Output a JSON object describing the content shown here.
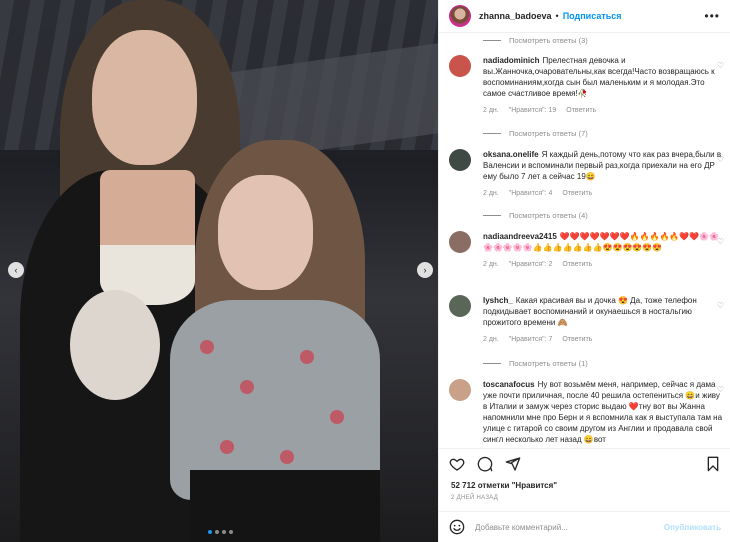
{
  "header": {
    "username": "zhanna_badoeva",
    "separator": "•",
    "follow_label": "Подписаться",
    "more_icon": "more-horizontal-icon"
  },
  "photo": {
    "prev_icon": "chevron-left-icon",
    "next_icon": "chevron-right-icon",
    "prev_glyph": "‹",
    "next_glyph": "›",
    "carousel_count": 4,
    "carousel_active": 1
  },
  "comments": [
    {
      "username": "nadiadominich",
      "text": "Прелестная девочка и вы.Жанночка,очаровательны,как всегда!Часто возвращаюсь к воспоминаниям,когда сын был маленьким и я молодая.Это самое счастливое время!🥀",
      "time": "2 дн.",
      "likes": "\"Нравится\": 19",
      "reply": "Ответить",
      "view_replies": "Посмотреть ответы (7)",
      "avatar_color": "#c8544b"
    },
    {
      "username": "oksana.onelife",
      "text": "Я каждый день,потому что как раз вчера,были в Валенсии и вспоминали первый раз,когда приехали на его ДР ему было 7 лет а сейчас 19😄",
      "time": "2 дн.",
      "likes": "\"Нравится\": 4",
      "reply": "Ответить",
      "view_replies": "Посмотреть ответы (4)",
      "avatar_color": "#3f4a44"
    },
    {
      "username": "nadiaandreeva2415",
      "text": "❤️❤️❤️❤️❤️❤️❤️🔥🔥🔥🔥🔥❤️❤️🌸🌸🌸🌸🌸🌸🌸👍👍👍👍👍👍👍😍😍😍😍😍😍",
      "time": "2 дн.",
      "likes": "\"Нравится\": 2",
      "reply": "Ответить",
      "view_replies": "",
      "avatar_color": "#8a6d63"
    },
    {
      "username": "lyshch_",
      "text": "Какая красивая вы и дочка 😍 Да, тоже телефон подкидывает воспоминаний и окунаешься в ностальгию прожитого времени 🙈",
      "time": "2 дн.",
      "likes": "\"Нравится\": 7",
      "reply": "Ответить",
      "view_replies": "Посмотреть ответы (1)",
      "avatar_color": "#5a6658"
    },
    {
      "username": "toscanafocus",
      "text": "Ну вот возьмём меня, например, сейчас я дама уже почти приличная, после 40 решила остепениться 😄и живу в Италии и замуж через сторис выдаю ❤️тну вот вы Жанна напомнили мне про Берн и я вспомнила как я выступала там на улице с гитарой со своим другом из Англии и продавала свой сингл несколько лет назад 😄вот",
      "time": "",
      "likes": "",
      "reply": "",
      "view_replies": "",
      "avatar_color": "#c9a189"
    }
  ],
  "top_view_replies": "Посмотреть ответы (3)",
  "actions": {
    "like_icon": "heart-icon",
    "comment_icon": "comment-icon",
    "share_icon": "share-icon",
    "save_icon": "bookmark-icon"
  },
  "likes_text": "52 712 отметки \"Нравится\"",
  "date_text": "2 ДНЕЙ НАЗАД",
  "add_comment": {
    "placeholder": "Добавьте комментарий...",
    "publish_label": "Опубликовать",
    "emoji_icon": "smile-icon"
  }
}
